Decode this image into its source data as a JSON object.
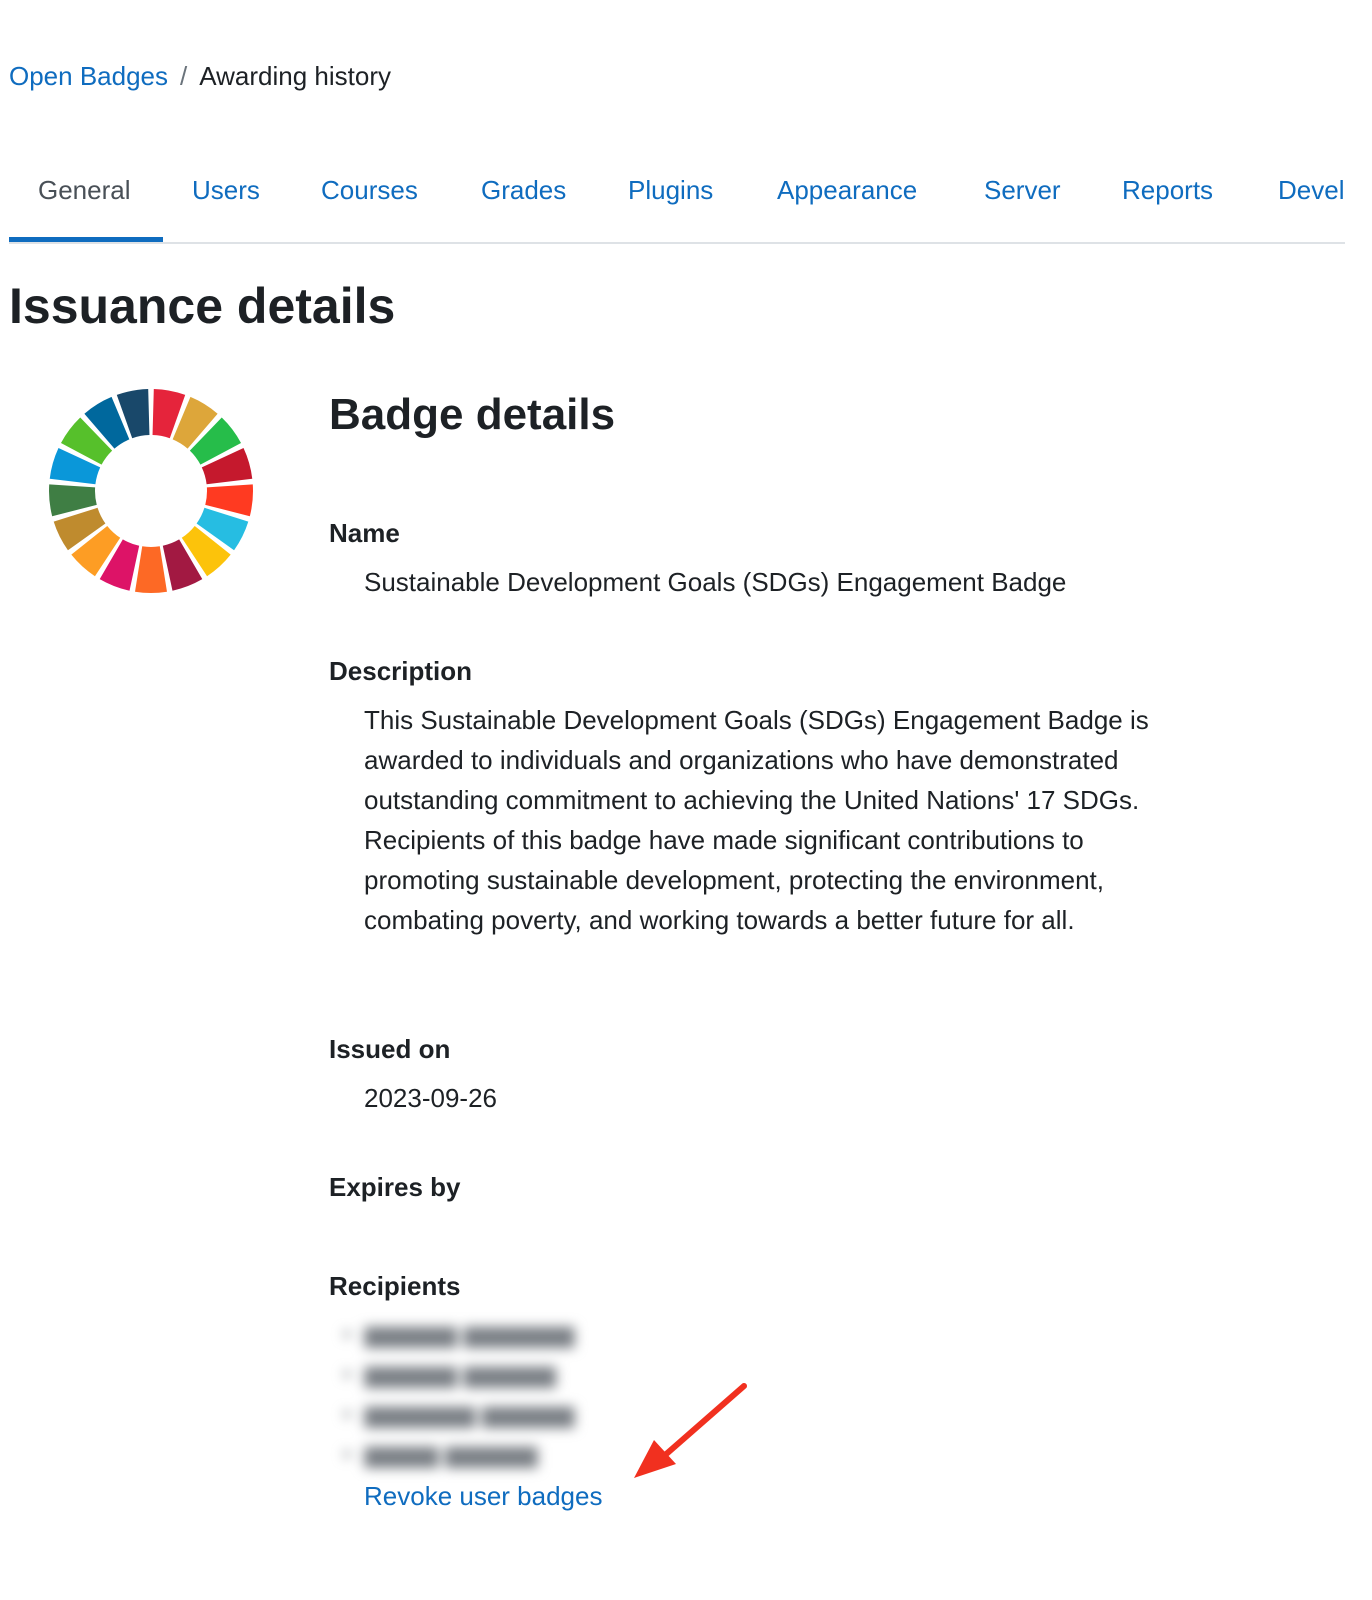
{
  "breadcrumb": {
    "parent": "Open Badges",
    "separator": "/",
    "current": "Awarding history"
  },
  "tabs": [
    {
      "label": "General",
      "active": true
    },
    {
      "label": "Users",
      "active": false
    },
    {
      "label": "Courses",
      "active": false
    },
    {
      "label": "Grades",
      "active": false
    },
    {
      "label": "Plugins",
      "active": false
    },
    {
      "label": "Appearance",
      "active": false
    },
    {
      "label": "Server",
      "active": false
    },
    {
      "label": "Reports",
      "active": false
    },
    {
      "label": "Devel",
      "active": false
    }
  ],
  "page_title": "Issuance details",
  "badge_details": {
    "title": "Badge details",
    "name_label": "Name",
    "name_value": "Sustainable Development Goals (SDGs) Engagement Badge",
    "description_label": "Description",
    "description_value": "This Sustainable Development Goals (SDGs) Engagement Badge is awarded to individuals and organizations who have demonstrated outstanding commitment to achieving the United Nations' 17 SDGs. Recipients of this badge have made significant contributions to promoting sustainable development, protecting the environment, combating poverty, and working towards a better future for all.",
    "issued_label": "Issued on",
    "issued_value": "2023-09-26",
    "expires_label": "Expires by",
    "recipients_label": "Recipients"
  },
  "revoke_label": "Revoke user badges",
  "badge_colors": [
    "#e5243b",
    "#dda63a",
    "#26bd4a",
    "#c5192d",
    "#ff3a21",
    "#26bde2",
    "#fcc30b",
    "#a21942",
    "#fd6925",
    "#dd1367",
    "#fd9d24",
    "#bf8b2e",
    "#3f7e44",
    "#0a97d9",
    "#56c02b",
    "#00689d",
    "#19486a"
  ],
  "colors": {
    "link": "#0f6cbf",
    "text": "#1d2125",
    "annotation_arrow": "#f1301f"
  }
}
